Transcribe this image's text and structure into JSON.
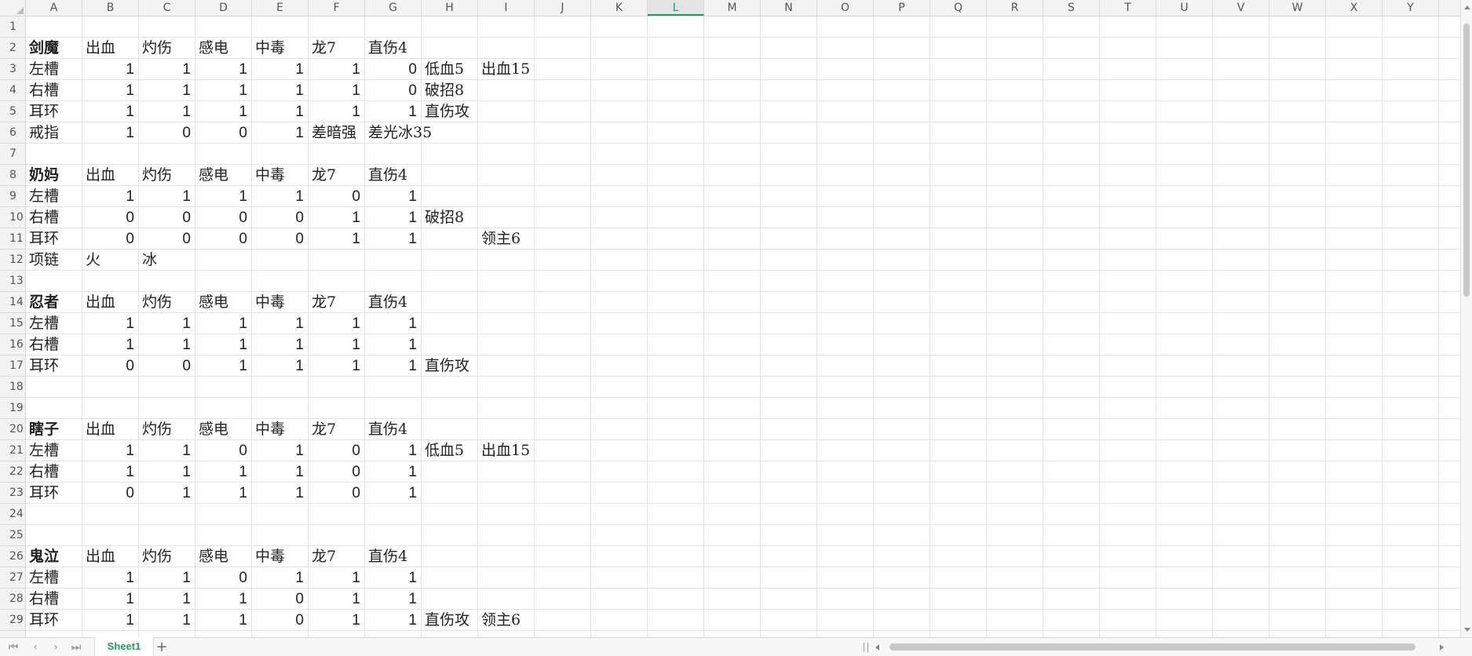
{
  "columns": [
    "A",
    "B",
    "C",
    "D",
    "E",
    "F",
    "G",
    "H",
    "I",
    "J",
    "K",
    "L",
    "M",
    "N",
    "O",
    "P",
    "Q",
    "R",
    "S",
    "T",
    "U",
    "V",
    "W",
    "X",
    "Y"
  ],
  "active_column": "L",
  "rows": [
    1,
    2,
    3,
    4,
    5,
    6,
    7,
    8,
    9,
    10,
    11,
    12,
    13,
    14,
    15,
    16,
    17,
    18,
    19,
    20,
    21,
    22,
    23,
    24,
    25,
    26,
    27,
    28,
    29
  ],
  "cells": [
    {
      "r": 2,
      "c": 0,
      "v": "剑魔",
      "bold": true
    },
    {
      "r": 2,
      "c": 1,
      "v": "出血"
    },
    {
      "r": 2,
      "c": 2,
      "v": "灼伤"
    },
    {
      "r": 2,
      "c": 3,
      "v": "感电"
    },
    {
      "r": 2,
      "c": 4,
      "v": "中毒"
    },
    {
      "r": 2,
      "c": 5,
      "v": "龙7"
    },
    {
      "r": 2,
      "c": 6,
      "v": "直伤4"
    },
    {
      "r": 3,
      "c": 0,
      "v": "左槽"
    },
    {
      "r": 3,
      "c": 1,
      "v": "1",
      "num": true
    },
    {
      "r": 3,
      "c": 2,
      "v": "1",
      "num": true
    },
    {
      "r": 3,
      "c": 3,
      "v": "1",
      "num": true
    },
    {
      "r": 3,
      "c": 4,
      "v": "1",
      "num": true
    },
    {
      "r": 3,
      "c": 5,
      "v": "1",
      "num": true
    },
    {
      "r": 3,
      "c": 6,
      "v": "0",
      "num": true
    },
    {
      "r": 3,
      "c": 7,
      "v": "低血5"
    },
    {
      "r": 3,
      "c": 8,
      "v": "出血15"
    },
    {
      "r": 4,
      "c": 0,
      "v": "右槽"
    },
    {
      "r": 4,
      "c": 1,
      "v": "1",
      "num": true
    },
    {
      "r": 4,
      "c": 2,
      "v": "1",
      "num": true
    },
    {
      "r": 4,
      "c": 3,
      "v": "1",
      "num": true
    },
    {
      "r": 4,
      "c": 4,
      "v": "1",
      "num": true
    },
    {
      "r": 4,
      "c": 5,
      "v": "1",
      "num": true
    },
    {
      "r": 4,
      "c": 6,
      "v": "0",
      "num": true
    },
    {
      "r": 4,
      "c": 7,
      "v": "破招8"
    },
    {
      "r": 5,
      "c": 0,
      "v": "耳环"
    },
    {
      "r": 5,
      "c": 1,
      "v": "1",
      "num": true
    },
    {
      "r": 5,
      "c": 2,
      "v": "1",
      "num": true
    },
    {
      "r": 5,
      "c": 3,
      "v": "1",
      "num": true
    },
    {
      "r": 5,
      "c": 4,
      "v": "1",
      "num": true
    },
    {
      "r": 5,
      "c": 5,
      "v": "1",
      "num": true
    },
    {
      "r": 5,
      "c": 6,
      "v": "1",
      "num": true
    },
    {
      "r": 5,
      "c": 7,
      "v": "直伤攻"
    },
    {
      "r": 6,
      "c": 0,
      "v": "戒指"
    },
    {
      "r": 6,
      "c": 1,
      "v": "1",
      "num": true
    },
    {
      "r": 6,
      "c": 2,
      "v": "0",
      "num": true
    },
    {
      "r": 6,
      "c": 3,
      "v": "0",
      "num": true
    },
    {
      "r": 6,
      "c": 4,
      "v": "1",
      "num": true
    },
    {
      "r": 6,
      "c": 5,
      "v": "差暗强"
    },
    {
      "r": 6,
      "c": 6,
      "v": "差光冰35"
    },
    {
      "r": 8,
      "c": 0,
      "v": "奶妈",
      "bold": true
    },
    {
      "r": 8,
      "c": 1,
      "v": "出血"
    },
    {
      "r": 8,
      "c": 2,
      "v": "灼伤"
    },
    {
      "r": 8,
      "c": 3,
      "v": "感电"
    },
    {
      "r": 8,
      "c": 4,
      "v": "中毒"
    },
    {
      "r": 8,
      "c": 5,
      "v": "龙7"
    },
    {
      "r": 8,
      "c": 6,
      "v": "直伤4"
    },
    {
      "r": 9,
      "c": 0,
      "v": "左槽"
    },
    {
      "r": 9,
      "c": 1,
      "v": "1",
      "num": true
    },
    {
      "r": 9,
      "c": 2,
      "v": "1",
      "num": true
    },
    {
      "r": 9,
      "c": 3,
      "v": "1",
      "num": true
    },
    {
      "r": 9,
      "c": 4,
      "v": "1",
      "num": true
    },
    {
      "r": 9,
      "c": 5,
      "v": "0",
      "num": true
    },
    {
      "r": 9,
      "c": 6,
      "v": "1",
      "num": true
    },
    {
      "r": 10,
      "c": 0,
      "v": "右槽"
    },
    {
      "r": 10,
      "c": 1,
      "v": "0",
      "num": true
    },
    {
      "r": 10,
      "c": 2,
      "v": "0",
      "num": true
    },
    {
      "r": 10,
      "c": 3,
      "v": "0",
      "num": true
    },
    {
      "r": 10,
      "c": 4,
      "v": "0",
      "num": true
    },
    {
      "r": 10,
      "c": 5,
      "v": "1",
      "num": true
    },
    {
      "r": 10,
      "c": 6,
      "v": "1",
      "num": true
    },
    {
      "r": 10,
      "c": 7,
      "v": "破招8"
    },
    {
      "r": 11,
      "c": 0,
      "v": "耳环"
    },
    {
      "r": 11,
      "c": 1,
      "v": "0",
      "num": true
    },
    {
      "r": 11,
      "c": 2,
      "v": "0",
      "num": true
    },
    {
      "r": 11,
      "c": 3,
      "v": "0",
      "num": true
    },
    {
      "r": 11,
      "c": 4,
      "v": "0",
      "num": true
    },
    {
      "r": 11,
      "c": 5,
      "v": "1",
      "num": true
    },
    {
      "r": 11,
      "c": 6,
      "v": "1",
      "num": true
    },
    {
      "r": 11,
      "c": 8,
      "v": "领主6"
    },
    {
      "r": 12,
      "c": 0,
      "v": "项链"
    },
    {
      "r": 12,
      "c": 1,
      "v": "火"
    },
    {
      "r": 12,
      "c": 2,
      "v": "冰"
    },
    {
      "r": 14,
      "c": 0,
      "v": "忍者",
      "bold": true
    },
    {
      "r": 14,
      "c": 1,
      "v": "出血"
    },
    {
      "r": 14,
      "c": 2,
      "v": "灼伤"
    },
    {
      "r": 14,
      "c": 3,
      "v": "感电"
    },
    {
      "r": 14,
      "c": 4,
      "v": "中毒"
    },
    {
      "r": 14,
      "c": 5,
      "v": "龙7"
    },
    {
      "r": 14,
      "c": 6,
      "v": "直伤4"
    },
    {
      "r": 15,
      "c": 0,
      "v": "左槽"
    },
    {
      "r": 15,
      "c": 1,
      "v": "1",
      "num": true
    },
    {
      "r": 15,
      "c": 2,
      "v": "1",
      "num": true
    },
    {
      "r": 15,
      "c": 3,
      "v": "1",
      "num": true
    },
    {
      "r": 15,
      "c": 4,
      "v": "1",
      "num": true
    },
    {
      "r": 15,
      "c": 5,
      "v": "1",
      "num": true
    },
    {
      "r": 15,
      "c": 6,
      "v": "1",
      "num": true
    },
    {
      "r": 16,
      "c": 0,
      "v": "右槽"
    },
    {
      "r": 16,
      "c": 1,
      "v": "1",
      "num": true
    },
    {
      "r": 16,
      "c": 2,
      "v": "1",
      "num": true
    },
    {
      "r": 16,
      "c": 3,
      "v": "1",
      "num": true
    },
    {
      "r": 16,
      "c": 4,
      "v": "1",
      "num": true
    },
    {
      "r": 16,
      "c": 5,
      "v": "1",
      "num": true
    },
    {
      "r": 16,
      "c": 6,
      "v": "1",
      "num": true
    },
    {
      "r": 17,
      "c": 0,
      "v": "耳环"
    },
    {
      "r": 17,
      "c": 1,
      "v": "0",
      "num": true
    },
    {
      "r": 17,
      "c": 2,
      "v": "0",
      "num": true
    },
    {
      "r": 17,
      "c": 3,
      "v": "1",
      "num": true
    },
    {
      "r": 17,
      "c": 4,
      "v": "1",
      "num": true
    },
    {
      "r": 17,
      "c": 5,
      "v": "1",
      "num": true
    },
    {
      "r": 17,
      "c": 6,
      "v": "1",
      "num": true
    },
    {
      "r": 17,
      "c": 7,
      "v": "直伤攻"
    },
    {
      "r": 20,
      "c": 0,
      "v": "瞎子",
      "bold": true
    },
    {
      "r": 20,
      "c": 1,
      "v": "出血"
    },
    {
      "r": 20,
      "c": 2,
      "v": "灼伤"
    },
    {
      "r": 20,
      "c": 3,
      "v": "感电"
    },
    {
      "r": 20,
      "c": 4,
      "v": "中毒"
    },
    {
      "r": 20,
      "c": 5,
      "v": "龙7"
    },
    {
      "r": 20,
      "c": 6,
      "v": "直伤4"
    },
    {
      "r": 21,
      "c": 0,
      "v": "左槽"
    },
    {
      "r": 21,
      "c": 1,
      "v": "1",
      "num": true
    },
    {
      "r": 21,
      "c": 2,
      "v": "1",
      "num": true
    },
    {
      "r": 21,
      "c": 3,
      "v": "0",
      "num": true
    },
    {
      "r": 21,
      "c": 4,
      "v": "1",
      "num": true
    },
    {
      "r": 21,
      "c": 5,
      "v": "0",
      "num": true
    },
    {
      "r": 21,
      "c": 6,
      "v": "1",
      "num": true
    },
    {
      "r": 21,
      "c": 7,
      "v": "低血5"
    },
    {
      "r": 21,
      "c": 8,
      "v": "出血15"
    },
    {
      "r": 22,
      "c": 0,
      "v": "右槽"
    },
    {
      "r": 22,
      "c": 1,
      "v": "1",
      "num": true
    },
    {
      "r": 22,
      "c": 2,
      "v": "1",
      "num": true
    },
    {
      "r": 22,
      "c": 3,
      "v": "1",
      "num": true
    },
    {
      "r": 22,
      "c": 4,
      "v": "1",
      "num": true
    },
    {
      "r": 22,
      "c": 5,
      "v": "0",
      "num": true
    },
    {
      "r": 22,
      "c": 6,
      "v": "1",
      "num": true
    },
    {
      "r": 23,
      "c": 0,
      "v": "耳环"
    },
    {
      "r": 23,
      "c": 1,
      "v": "0",
      "num": true
    },
    {
      "r": 23,
      "c": 2,
      "v": "1",
      "num": true
    },
    {
      "r": 23,
      "c": 3,
      "v": "1",
      "num": true
    },
    {
      "r": 23,
      "c": 4,
      "v": "1",
      "num": true
    },
    {
      "r": 23,
      "c": 5,
      "v": "0",
      "num": true
    },
    {
      "r": 23,
      "c": 6,
      "v": "1",
      "num": true
    },
    {
      "r": 26,
      "c": 0,
      "v": "鬼泣",
      "bold": true
    },
    {
      "r": 26,
      "c": 1,
      "v": "出血"
    },
    {
      "r": 26,
      "c": 2,
      "v": "灼伤"
    },
    {
      "r": 26,
      "c": 3,
      "v": "感电"
    },
    {
      "r": 26,
      "c": 4,
      "v": "中毒"
    },
    {
      "r": 26,
      "c": 5,
      "v": "龙7"
    },
    {
      "r": 26,
      "c": 6,
      "v": "直伤4"
    },
    {
      "r": 27,
      "c": 0,
      "v": "左槽"
    },
    {
      "r": 27,
      "c": 1,
      "v": "1",
      "num": true
    },
    {
      "r": 27,
      "c": 2,
      "v": "1",
      "num": true
    },
    {
      "r": 27,
      "c": 3,
      "v": "0",
      "num": true
    },
    {
      "r": 27,
      "c": 4,
      "v": "1",
      "num": true
    },
    {
      "r": 27,
      "c": 5,
      "v": "1",
      "num": true
    },
    {
      "r": 27,
      "c": 6,
      "v": "1",
      "num": true
    },
    {
      "r": 28,
      "c": 0,
      "v": "右槽"
    },
    {
      "r": 28,
      "c": 1,
      "v": "1",
      "num": true
    },
    {
      "r": 28,
      "c": 2,
      "v": "1",
      "num": true
    },
    {
      "r": 28,
      "c": 3,
      "v": "1",
      "num": true
    },
    {
      "r": 28,
      "c": 4,
      "v": "0",
      "num": true
    },
    {
      "r": 28,
      "c": 5,
      "v": "1",
      "num": true
    },
    {
      "r": 28,
      "c": 6,
      "v": "1",
      "num": true
    },
    {
      "r": 29,
      "c": 0,
      "v": "耳环"
    },
    {
      "r": 29,
      "c": 1,
      "v": "1",
      "num": true
    },
    {
      "r": 29,
      "c": 2,
      "v": "1",
      "num": true
    },
    {
      "r": 29,
      "c": 3,
      "v": "1",
      "num": true
    },
    {
      "r": 29,
      "c": 4,
      "v": "0",
      "num": true
    },
    {
      "r": 29,
      "c": 5,
      "v": "1",
      "num": true
    },
    {
      "r": 29,
      "c": 6,
      "v": "1",
      "num": true
    },
    {
      "r": 29,
      "c": 7,
      "v": "直伤攻"
    },
    {
      "r": 29,
      "c": 8,
      "v": "领主6"
    }
  ],
  "bottom": {
    "sheet_tab": "Sheet1",
    "nav_first": "⏮",
    "nav_prev": "‹",
    "nav_next": "›",
    "nav_last": "⏭",
    "add_sheet": "+"
  },
  "colors": {
    "accent": "#1e9e62",
    "header_bg": "#f3f3f3",
    "gridline": "#e2e2e2"
  }
}
